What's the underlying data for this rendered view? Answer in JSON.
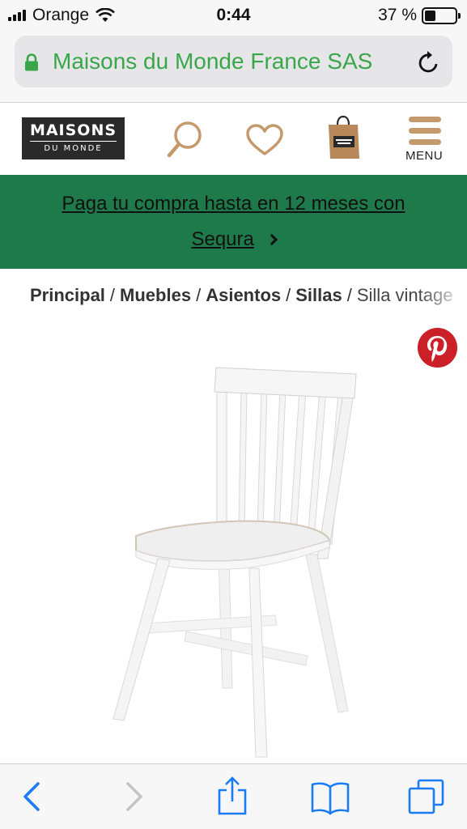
{
  "status": {
    "carrier": "Orange",
    "time": "0:44",
    "battery_percent": "37 %",
    "battery_level": 0.37
  },
  "browser": {
    "url_label": "Maisons du Monde France SAS"
  },
  "header": {
    "logo_line1": "MAISONS",
    "logo_line2": "DU MONDE",
    "menu_label": "MENU"
  },
  "promo": {
    "line1": "Paga tu compra hasta en 12 meses con",
    "line2": "Sequra"
  },
  "breadcrumb": {
    "items": [
      "Principal",
      "Muebles",
      "Asientos",
      "Sillas"
    ],
    "separator": "/",
    "current": "Silla vintage"
  },
  "colors": {
    "promo_bg": "#1e7a4a",
    "url_green": "#3aa64c",
    "ios_blue": "#1a7cf5",
    "pinterest_red": "#cb2027"
  },
  "icons": [
    "lock-icon",
    "reload-icon",
    "search-icon",
    "heart-icon",
    "shopping-bag-icon",
    "menu-icon",
    "pinterest-icon",
    "back-icon",
    "forward-icon",
    "share-icon",
    "bookmarks-icon",
    "tabs-icon"
  ]
}
